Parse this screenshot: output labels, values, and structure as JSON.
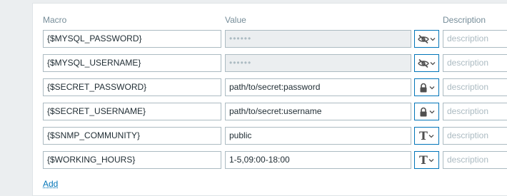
{
  "headers": {
    "macro": "Macro",
    "value": "Value",
    "description": "Description"
  },
  "rows": [
    {
      "macro": "{$MYSQL_PASSWORD}",
      "value": "••••••",
      "type": "secret",
      "type_icon": "eye-slash-icon",
      "description_placeholder": "description"
    },
    {
      "macro": "{$MYSQL_USERNAME}",
      "value": "••••••",
      "type": "secret",
      "type_icon": "eye-slash-icon",
      "description_placeholder": "description"
    },
    {
      "macro": "{$SECRET_PASSWORD}",
      "value": "path/to/secret:password",
      "type": "vault",
      "type_icon": "lock-icon",
      "description_placeholder": "description"
    },
    {
      "macro": "{$SECRET_USERNAME}",
      "value": "path/to/secret:username",
      "type": "vault",
      "type_icon": "lock-icon",
      "description_placeholder": "description"
    },
    {
      "macro": "{$SNMP_COMMUNITY}",
      "value": "public",
      "type": "text",
      "type_icon": "text-t-icon",
      "description_placeholder": "description"
    },
    {
      "macro": "{$WORKING_HOURS}",
      "value": "1-5,09:00-18:00",
      "type": "text",
      "type_icon": "text-t-icon",
      "description_placeholder": "description"
    }
  ],
  "add_label": "Add",
  "colors": {
    "accent": "#0275b8",
    "border": "#acbbc2",
    "header_text": "#768d99",
    "disabled_bg": "#ebeef0"
  }
}
